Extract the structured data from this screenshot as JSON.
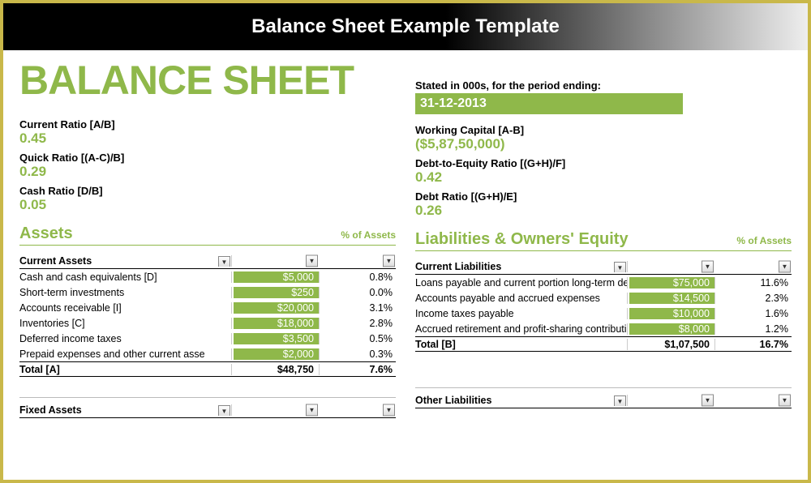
{
  "banner": "Balance Sheet Example Template",
  "title": "BALANCE SHEET",
  "period": {
    "caption": "Stated in 000s, for the period ending:",
    "date": "31-12-2013"
  },
  "ratios_left": [
    {
      "label": "Current Ratio   [A/B]",
      "value": "0.45"
    },
    {
      "label": "Quick Ratio   [(A-C)/B]",
      "value": "0.29"
    },
    {
      "label": "Cash Ratio   [D/B]",
      "value": "0.05"
    }
  ],
  "ratios_right": [
    {
      "label": "Working Capital   [A-B]",
      "value": "($5,87,50,000)"
    },
    {
      "label": "Debt-to-Equity Ratio   [(G+H)/F]",
      "value": "0.42"
    },
    {
      "label": "Debt Ratio   [(G+H)/E]",
      "value": "0.26"
    }
  ],
  "left_section": {
    "title": "Assets",
    "pct_label": "% of Assets",
    "group": "Current Assets",
    "rows": [
      {
        "label": "Cash and cash equivalents   [D]",
        "value": "$5,000",
        "pct": "0.8%"
      },
      {
        "label": "Short-term investments",
        "value": "$250",
        "pct": "0.0%"
      },
      {
        "label": "Accounts receivable   [I]",
        "value": "$20,000",
        "pct": "3.1%"
      },
      {
        "label": "Inventories   [C]",
        "value": "$18,000",
        "pct": "2.8%"
      },
      {
        "label": "Deferred income taxes",
        "value": "$3,500",
        "pct": "0.5%"
      },
      {
        "label": "Prepaid expenses and other current asse",
        "value": "$2,000",
        "pct": "0.3%"
      }
    ],
    "total": {
      "label": "Total   [A]",
      "value": "$48,750",
      "pct": "7.6%"
    },
    "next_group": "Fixed Assets"
  },
  "right_section": {
    "title": "Liabilities & Owners' Equity",
    "pct_label": "% of Assets",
    "group": "Current Liabilities",
    "rows": [
      {
        "label": "Loans payable and current portion long-term debt",
        "value": "$75,000",
        "pct": "11.6%"
      },
      {
        "label": "Accounts payable and accrued expenses",
        "value": "$14,500",
        "pct": "2.3%"
      },
      {
        "label": "Income taxes payable",
        "value": "$10,000",
        "pct": "1.6%"
      },
      {
        "label": "Accrued retirement and profit-sharing contributions",
        "value": "$8,000",
        "pct": "1.2%"
      }
    ],
    "total": {
      "label": "Total   [B]",
      "value": "$1,07,500",
      "pct": "16.7%"
    },
    "next_group": "Other Liabilities"
  }
}
